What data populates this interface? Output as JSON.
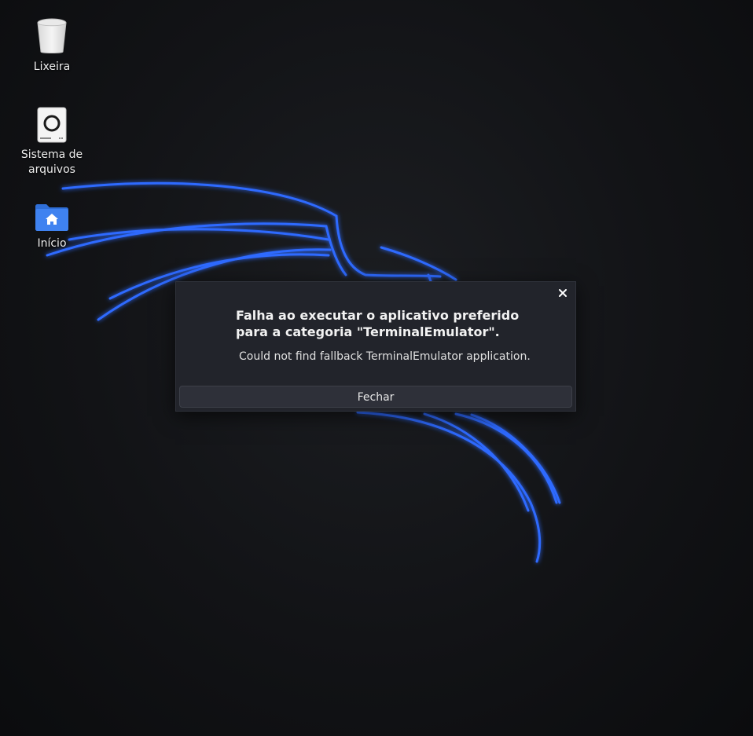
{
  "desktop": {
    "icons": [
      {
        "label": "Lixeira",
        "icon": "trash-icon"
      },
      {
        "label": "Sistema de arquivos",
        "icon": "drive-icon"
      },
      {
        "label": "Início",
        "icon": "home-folder-icon"
      }
    ]
  },
  "dialog": {
    "title": "Falha ao executar o aplicativo preferido para a categoria \"TerminalEmulator\".",
    "message": "Could not find fallback TerminalEmulator application.",
    "close_label": "Fechar",
    "close_icon": "close-icon"
  },
  "colors": {
    "accent": "#2f6bff",
    "dialog_bg": "#22242b",
    "folder_blue": "#3f82f0"
  }
}
